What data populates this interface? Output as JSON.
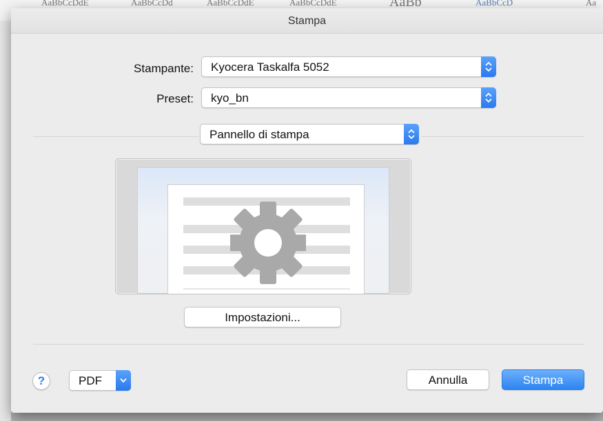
{
  "window": {
    "title": "Stampa"
  },
  "printer": {
    "label": "Stampante:",
    "value": "Kyocera Taskalfa 5052"
  },
  "preset": {
    "label": "Preset:",
    "value": "kyo_bn"
  },
  "panel": {
    "value": "Pannello di stampa"
  },
  "preview": {
    "icon": "gear-icon"
  },
  "settings_button": {
    "label": "Impostazioni..."
  },
  "footer": {
    "help_label": "?",
    "pdf_label": "PDF",
    "cancel_label": "Annulla",
    "print_label": "Stampa"
  },
  "colors": {
    "accent": "#2d84f1",
    "stepper": "#3a86f2",
    "sheet": "#ececec"
  },
  "icons": [
    "stepper-icon",
    "chevron-down-icon",
    "help-icon",
    "gear-icon"
  ]
}
